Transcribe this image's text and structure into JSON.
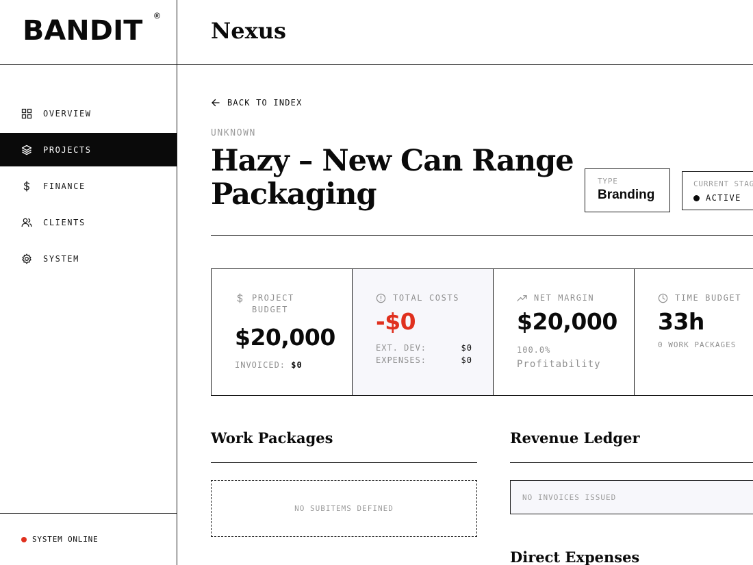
{
  "brand": {
    "name": "BANDIT",
    "mark": "®"
  },
  "header": {
    "title": "Nexus"
  },
  "sidebar": {
    "items": [
      {
        "label": "OVERVIEW",
        "icon": "grid-icon",
        "active": false
      },
      {
        "label": "PROJECTS",
        "icon": "layers-icon",
        "active": true
      },
      {
        "label": "FINANCE",
        "icon": "dollar-icon",
        "active": false
      },
      {
        "label": "CLIENTS",
        "icon": "users-icon",
        "active": false
      },
      {
        "label": "SYSTEM",
        "icon": "gear-icon",
        "active": false
      }
    ],
    "status": {
      "label": "SYSTEM ONLINE",
      "color": "#e0301e"
    }
  },
  "project": {
    "back_label": "BACK TO INDEX",
    "client": "UNKNOWN",
    "title": "Hazy – New Can Range Packaging",
    "type_label": "TYPE",
    "type_value": "Branding",
    "stage_label": "CURRENT STAGE",
    "stage_value": "ACTIVE"
  },
  "stats": {
    "budget": {
      "label": "PROJECT BUDGET",
      "value": "$20,000",
      "invoiced_label": "INVOICED:",
      "invoiced_value": "$0"
    },
    "costs": {
      "label": "TOTAL COSTS",
      "value": "-$0",
      "ext_dev_label": "EXT. DEV:",
      "ext_dev_value": "$0",
      "expenses_label": "EXPENSES:",
      "expenses_value": "$0"
    },
    "margin": {
      "label": "NET MARGIN",
      "value": "$20,000",
      "percent": "100.0%",
      "caption": "Profitability"
    },
    "time": {
      "label": "TIME BUDGET",
      "value": "33h",
      "sub": "0 WORK PACKAGES"
    }
  },
  "sections": {
    "work_packages": {
      "title": "Work Packages",
      "empty": "NO SUBITEMS DEFINED"
    },
    "revenue": {
      "title": "Revenue Ledger",
      "empty": "NO INVOICES ISSUED"
    },
    "expenses": {
      "title": "Direct Expenses"
    }
  },
  "colors": {
    "accent_red": "#e0301e",
    "ink": "#0a0a0a",
    "muted": "#9a9a9a",
    "tint": "#f7f7fb"
  }
}
